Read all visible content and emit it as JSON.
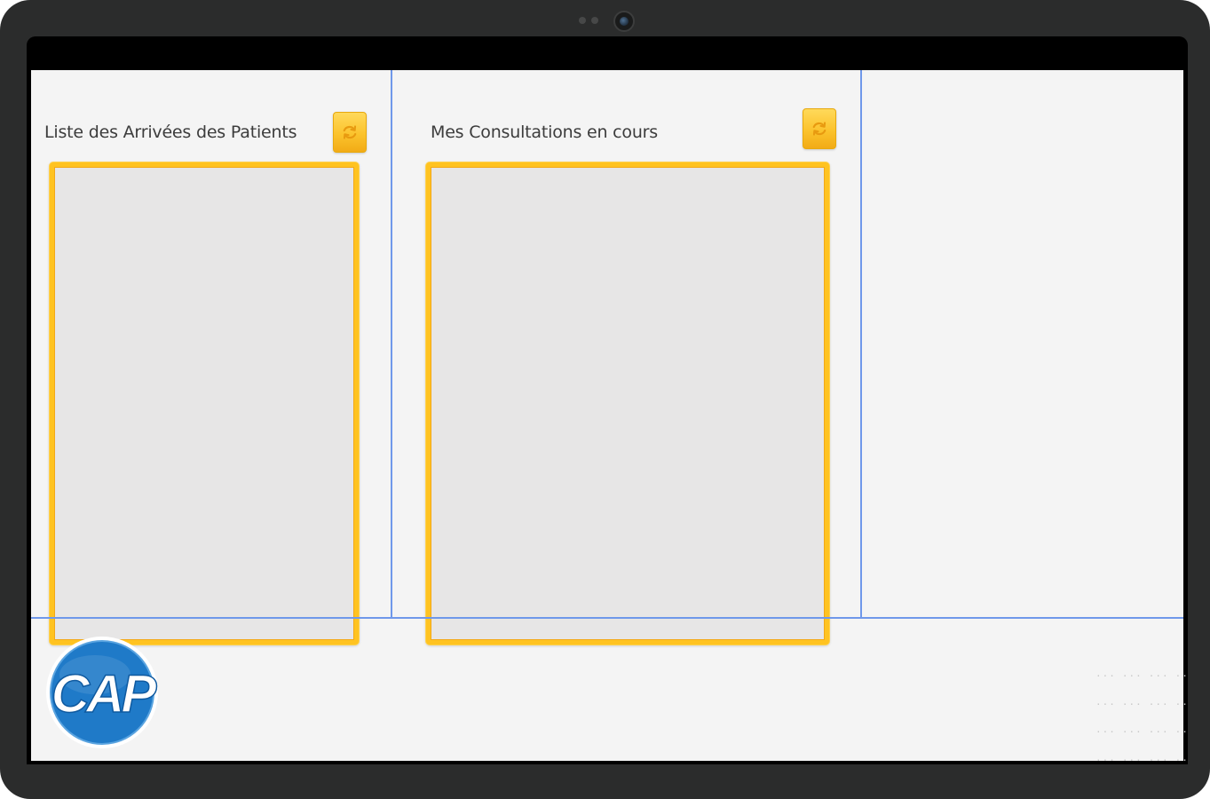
{
  "panels": {
    "arrivals": {
      "title": "Liste des Arrivées des Patients",
      "refresh_icon": "refresh-icon"
    },
    "consultations": {
      "title": "Mes Consultations en cours",
      "refresh_icon": "refresh-icon"
    }
  },
  "footer": {
    "logo_text": "CAP",
    "placeholder_rows": [
      [
        "···",
        "···",
        "···",
        "···"
      ],
      [
        "···",
        "···",
        "···",
        "···"
      ],
      [
        "···",
        "···",
        "···",
        "···"
      ],
      [
        "···",
        "···",
        "···",
        "···"
      ],
      [
        "···",
        "···",
        "···",
        "···"
      ]
    ]
  },
  "colors": {
    "accent_yellow": "#ffc321",
    "divider_blue": "#6f98ea",
    "logo_blue": "#1f7ac8",
    "device_frame": "#2b2c2c"
  }
}
